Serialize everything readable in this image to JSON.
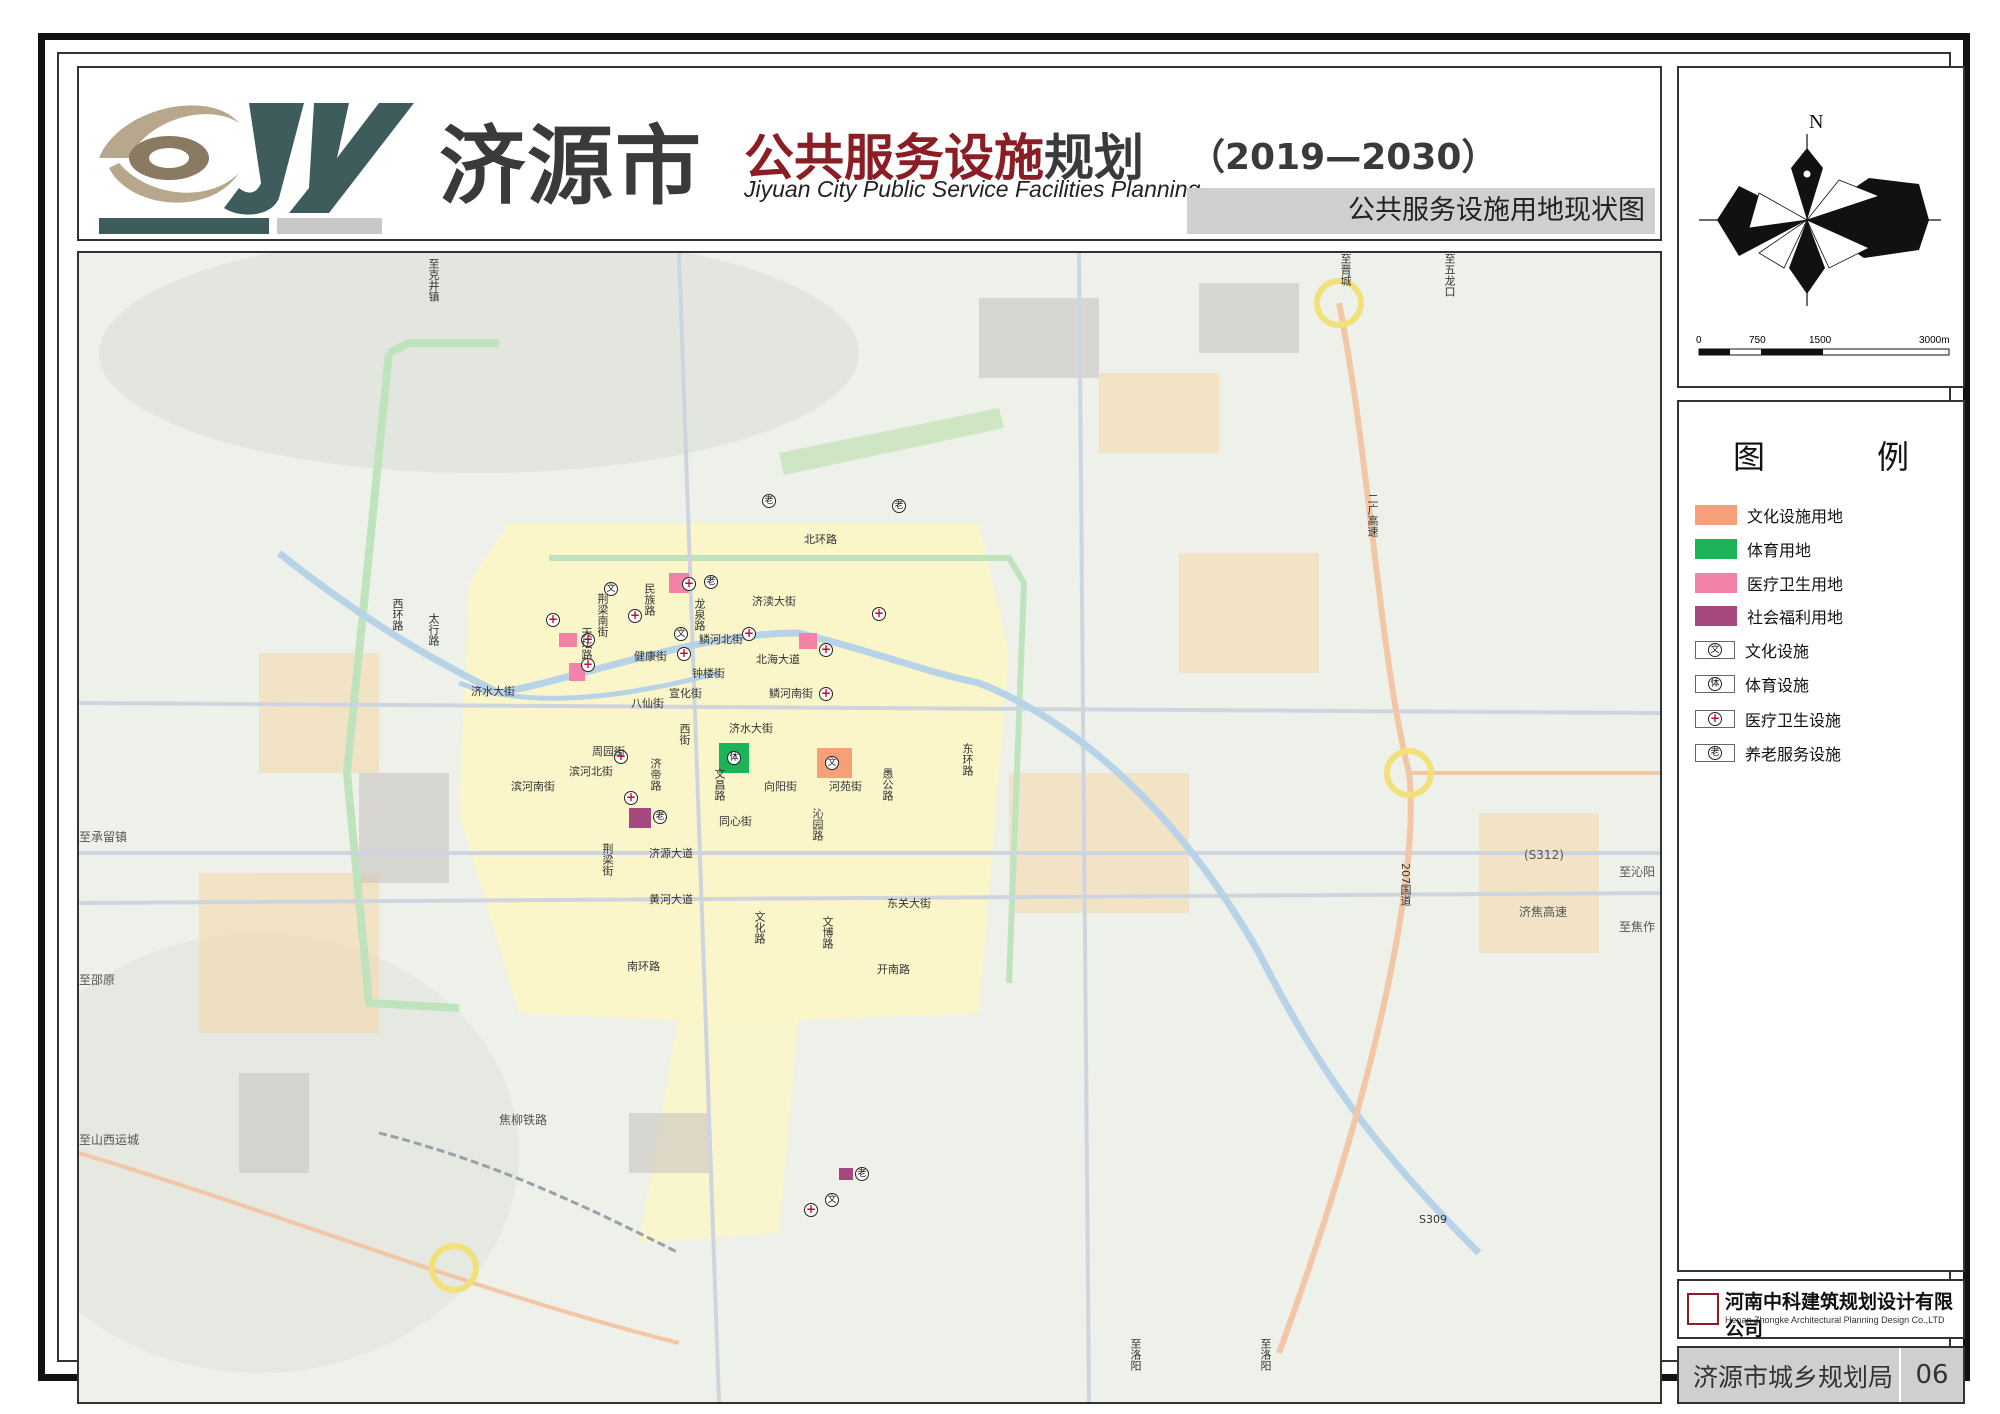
{
  "header": {
    "city": "济源市",
    "subject_red": "公共服务设施",
    "subject_dark": "规划",
    "years": "（2019—2030）",
    "english": "Jiyuan City Public Service Facilities Planning",
    "sheet_title": "公共服务设施用地现状图",
    "logo_letters": "JY"
  },
  "compass": {
    "north_label": "N",
    "scale_ticks": [
      "0",
      "750",
      "1500",
      "3000m"
    ]
  },
  "legend": {
    "title": "图　例",
    "items": [
      {
        "label": "文化设施用地",
        "type": "swatch",
        "color": "#f6a07a"
      },
      {
        "label": "体育用地",
        "type": "swatch",
        "color": "#1cb458"
      },
      {
        "label": "医疗卫生用地",
        "type": "swatch",
        "color": "#f382a8"
      },
      {
        "label": "社会福利用地",
        "type": "swatch",
        "color": "#a5497f"
      },
      {
        "label": "文化设施",
        "type": "symbol",
        "glyph": "文"
      },
      {
        "label": "体育设施",
        "type": "symbol",
        "glyph": "体"
      },
      {
        "label": "医疗卫生设施",
        "type": "symbol",
        "glyph": "+"
      },
      {
        "label": "养老服务设施",
        "type": "symbol",
        "glyph": "老"
      }
    ]
  },
  "footer": {
    "company_cn": "河南中科建筑规划设计有限公司",
    "company_en": "Henan Zhongke Architectural Planning Design Co.,LTD",
    "office": "济源市城乡规划局",
    "sheet_number": "06"
  },
  "map": {
    "road_labels": [
      {
        "text": "至克井镇"
      },
      {
        "text": "至晋城"
      },
      {
        "text": "至五龙口"
      },
      {
        "text": "北环路"
      },
      {
        "text": "西环路"
      },
      {
        "text": "太行路"
      },
      {
        "text": "民族路"
      },
      {
        "text": "龙泉路"
      },
      {
        "text": "济渎大街"
      },
      {
        "text": "荆梁南街"
      },
      {
        "text": "天坛路"
      },
      {
        "text": "健康街"
      },
      {
        "text": "鳞河北街"
      },
      {
        "text": "北海大道"
      },
      {
        "text": "钟楼街"
      },
      {
        "text": "济水大街"
      },
      {
        "text": "八仙街"
      },
      {
        "text": "宣化街"
      },
      {
        "text": "鳞河南街"
      },
      {
        "text": "西街"
      },
      {
        "text": "济水大街"
      },
      {
        "text": "周园街"
      },
      {
        "text": "滨河北街"
      },
      {
        "text": "济帝路"
      },
      {
        "text": "滨河南街"
      },
      {
        "text": "文昌路"
      },
      {
        "text": "向阳街"
      },
      {
        "text": "河苑街"
      },
      {
        "text": "愚公路"
      },
      {
        "text": "东环路"
      },
      {
        "text": "同心街"
      },
      {
        "text": "沁园路"
      },
      {
        "text": "至承留镇"
      },
      {
        "text": "荆梁街"
      },
      {
        "text": "济源大道"
      },
      {
        "text": "黄河大道"
      },
      {
        "text": "东关大街"
      },
      {
        "text": "文化路"
      },
      {
        "text": "文博路"
      },
      {
        "text": "南环路"
      },
      {
        "text": "开南路"
      },
      {
        "text": "至邵原"
      },
      {
        "text": "焦柳铁路"
      },
      {
        "text": "至山西运城"
      },
      {
        "text": "至沁阳"
      },
      {
        "text": "济焦高速"
      },
      {
        "text": "至焦作"
      },
      {
        "text": "(S312)"
      },
      {
        "text": "207国道"
      },
      {
        "text": "二广高速"
      },
      {
        "text": "S309"
      },
      {
        "text": "至洛阳"
      },
      {
        "text": "至洛阳"
      }
    ]
  }
}
